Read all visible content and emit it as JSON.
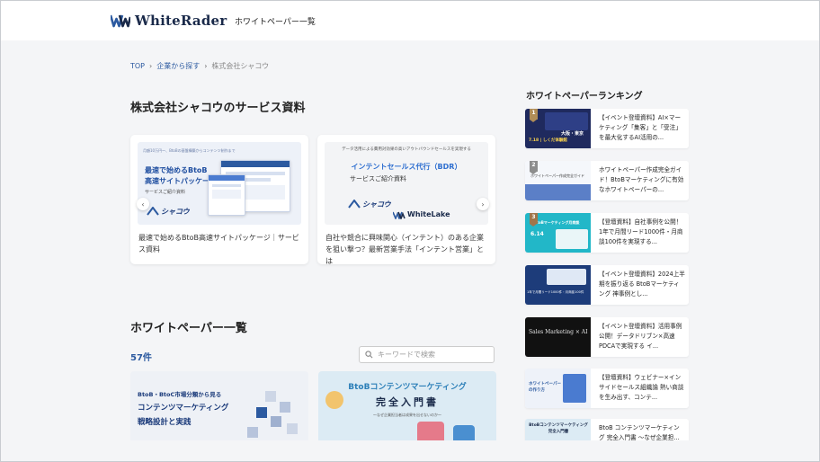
{
  "header": {
    "logo_text": "WhiteRader",
    "nav_link": "ホワイトペーパー一覧"
  },
  "breadcrumb": {
    "items": [
      "TOP",
      "企業から探す"
    ],
    "current": "株式会社シャコウ"
  },
  "service_section": {
    "title": "株式会社シャコウのサービス資料",
    "slides": [
      {
        "thumb_lines": [
          "最速で始めるBtoB",
          "高速サイトパッケージ",
          "サービスご紹介資料"
        ],
        "thumb_top": "月額10万円〜、BtoBの基盤構築からコンテンツ制作まで",
        "logo": "シャコウ",
        "caption": "最速で始めるBtoB高速サイトパッケージ｜サービス資料"
      },
      {
        "thumb_top": "データ活用による費用対効果の高いアウトバウンドセールスを実現する",
        "thumb_lines": [
          "インテントセールス代行（BDR）",
          "サービスご紹介資料"
        ],
        "logo": "シャコウ",
        "logo2": "WhiteLake",
        "caption": "自社や競合に興味関心（インテント）のある企業を狙い撃つ？最新営業手法「インテント営業」とは"
      }
    ],
    "arrow_prev": "‹",
    "arrow_next": "›"
  },
  "whitepaper_section": {
    "title": "ホワイトペーパー一覧",
    "count": "57件",
    "search_placeholder": "キーワードで検索",
    "cards": [
      {
        "lines": [
          "BtoB・BtoC市場分類から見る",
          "コンテンツマーケティング",
          "戦略設計と実践"
        ]
      },
      {
        "lines": [
          "BtoBコンテンツマーケティング",
          "完全入門書",
          "〜なぜ企業担当者は成果を出せないのか〜"
        ]
      }
    ]
  },
  "ranking": {
    "title": "ホワイトペーパーランキング",
    "items": [
      {
        "rank": "1",
        "text": "【イベント登壇資料】AI×マーケティング「集客」と「受注」を最大化するAI活用の...",
        "thumb_text": "大阪・東京",
        "thumb_sub": "7.18 | しくだ体験館"
      },
      {
        "rank": "2",
        "text": "ホワイトペーパー作成完全ガイド！BtoBマーケティングに有効なホワイトペーパーの...",
        "thumb_text": "ホワイトペーパー作成完全ガイド",
        "thumb_sub": ""
      },
      {
        "rank": "3",
        "text": "【登壇資料】自社事例を公開！1年で月間リード1000件・月商談100件を実現する...",
        "thumb_text": "BtoBマーケティング月商談",
        "thumb_sub": "6.14"
      },
      {
        "rank": "",
        "text": "【イベント登壇資料】2024上半期を振り返る BtoBマーケティング 神事例とし...",
        "thumb_text": "1年で月間リード1000件・月商談100件",
        "thumb_sub": ""
      },
      {
        "rank": "",
        "text": "【イベント登壇資料】活用事例公開！データドリブン×高速PDCAで実現する イ...",
        "thumb_text": "Sales Marketing × AI",
        "thumb_sub": ""
      },
      {
        "rank": "",
        "text": "【登壇資料】ウェビナー×インサイドセールス組織論 熱い商談を生み出す、コンテ...",
        "thumb_text": "ホワイトペーパーの作り方",
        "thumb_sub": ""
      },
      {
        "rank": "",
        "text": "BtoB コンテンツマーケティング 完全入門書 〜なぜ企業担...",
        "thumb_text": "BtoBコンテンツマーケティング 完全入門書",
        "thumb_sub": ""
      }
    ]
  },
  "colors": {
    "brand_navy": "#1a2a4a",
    "link_blue": "#2c5aa0",
    "rank_gold": "#b08d57",
    "rank_silver": "#8d8d8d",
    "rank_bronze": "#a0764a"
  }
}
